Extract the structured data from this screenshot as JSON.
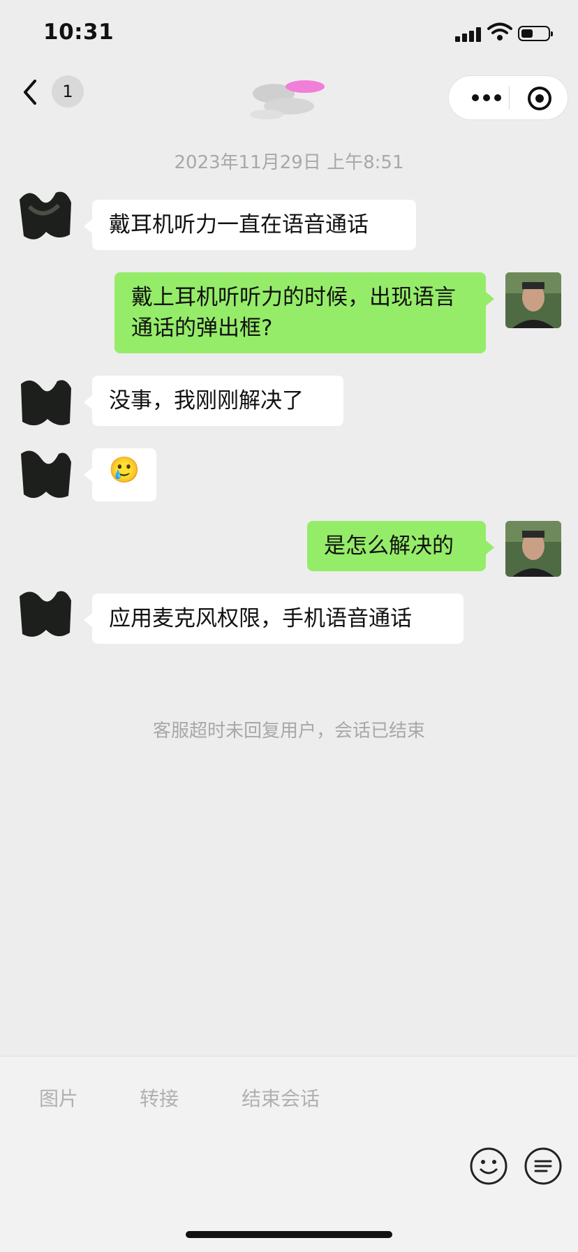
{
  "status_bar": {
    "time": "10:31",
    "battery_level": 0.45
  },
  "nav": {
    "unread_count": "1"
  },
  "chat": {
    "timestamp": "2023年11月29日 上午8:51",
    "messages": [
      {
        "sender": "agent",
        "text": "戴耳机听力一直在语音通话"
      },
      {
        "sender": "user",
        "text": "戴上耳机听听力的时候，出现语言通话的弹出框?"
      },
      {
        "sender": "agent",
        "text": "没事，我刚刚解决了"
      },
      {
        "sender": "agent",
        "text": "",
        "emoji": "🥲"
      },
      {
        "sender": "user",
        "text": "是怎么解决的"
      },
      {
        "sender": "agent",
        "text": "应用麦克风权限，手机语音通话"
      }
    ],
    "system_message": "客服超时未回复用户，会话已结束"
  },
  "toolbar": {
    "image_label": "图片",
    "transfer_label": "转接",
    "end_session_label": "结束会话"
  },
  "icons": [
    "back-icon",
    "more-icon",
    "close-icon",
    "emoji-icon",
    "menu-icon"
  ],
  "colors": {
    "outgoing_bubble": "#95ec69",
    "incoming_bubble": "#ffffff",
    "background": "#ededed"
  }
}
